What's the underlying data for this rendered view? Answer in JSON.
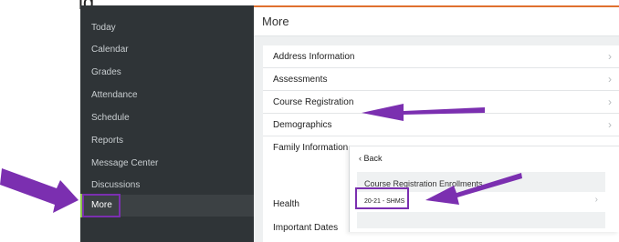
{
  "cut_title": "ig",
  "sidebar": {
    "items": [
      {
        "label": "Today"
      },
      {
        "label": "Calendar"
      },
      {
        "label": "Grades"
      },
      {
        "label": "Attendance"
      },
      {
        "label": "Schedule"
      },
      {
        "label": "Reports"
      },
      {
        "label": "Message Center"
      },
      {
        "label": "Discussions"
      },
      {
        "label": "More"
      }
    ],
    "active": "More"
  },
  "main": {
    "title": "More",
    "rows": [
      {
        "label": "Address Information"
      },
      {
        "label": "Assessments"
      },
      {
        "label": "Course Registration"
      },
      {
        "label": "Demographics"
      },
      {
        "label": "Family Information"
      },
      {
        "label": "Health"
      },
      {
        "label": "Important Dates"
      }
    ]
  },
  "popup": {
    "back_label": "Back",
    "enrollments_title": "Course Registration Enrollments",
    "enrollment_item": "20-21 - SHMS"
  },
  "annotation": {
    "arrow_color": "#7b2fb0"
  }
}
